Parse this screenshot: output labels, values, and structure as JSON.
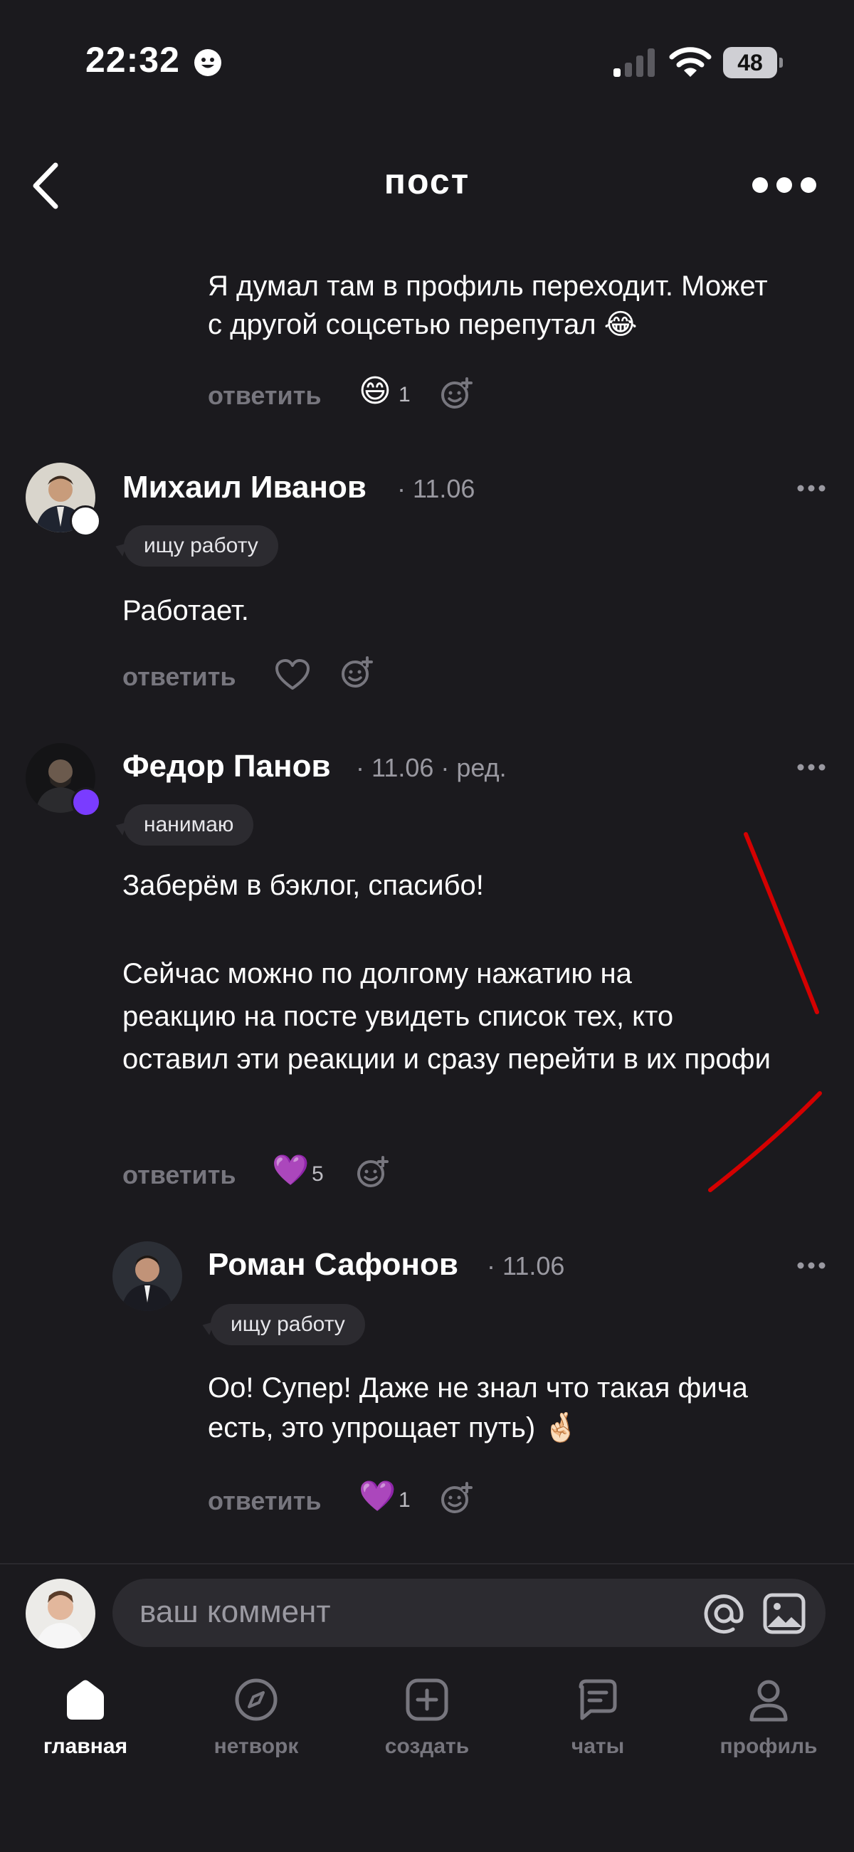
{
  "status_bar": {
    "time": "22:32",
    "battery": "48"
  },
  "header": {
    "title": "пост"
  },
  "comments": [
    {
      "text_lines": [
        "Я думал там в профиль переходит. Может",
        "с другой соцсетью перепутал 😂"
      ],
      "reply_label": "ответить",
      "reaction_emoji": "😄",
      "reaction_count": "1"
    },
    {
      "author": "Михаил Иванов",
      "meta": "· 11.06",
      "badge": "ищу работу",
      "text": "Работает.",
      "reply_label": "ответить"
    },
    {
      "author": "Федор Панов",
      "meta": "· 11.06 · ред.",
      "badge": "нанимаю",
      "text_lines": [
        "Заберём в бэклог, спасибо!",
        "",
        "Сейчас можно по долгому нажатию на",
        "реакцию на посте увидеть список тех, кто",
        "оставил эти реакции и сразу перейти в их профи"
      ],
      "reply_label": "ответить",
      "reaction_emoji": "💜",
      "reaction_count": "5"
    },
    {
      "author": "Роман Сафонов",
      "meta": "· 11.06",
      "badge": "ищу работу",
      "text_lines": [
        "Оо! Супер! Даже не знал что такая фича",
        "есть, это упрощает путь) 🤞🏻"
      ],
      "reply_label": "ответить",
      "reaction_emoji": "💜",
      "reaction_count": "1"
    }
  ],
  "composer": {
    "placeholder": "ваш коммент"
  },
  "bottom_nav": [
    {
      "label": "главная",
      "icon": "home-icon",
      "active": true
    },
    {
      "label": "нетворк",
      "icon": "compass-icon",
      "active": false
    },
    {
      "label": "создать",
      "icon": "plus-square-icon",
      "active": false
    },
    {
      "label": "чаты",
      "icon": "chat-icon",
      "active": false
    },
    {
      "label": "профиль",
      "icon": "person-icon",
      "active": false
    }
  ],
  "colors": {
    "background": "#1b1a1e",
    "annotation": "#d40000",
    "muted": "#77767e",
    "chip": "#2c2b30"
  }
}
